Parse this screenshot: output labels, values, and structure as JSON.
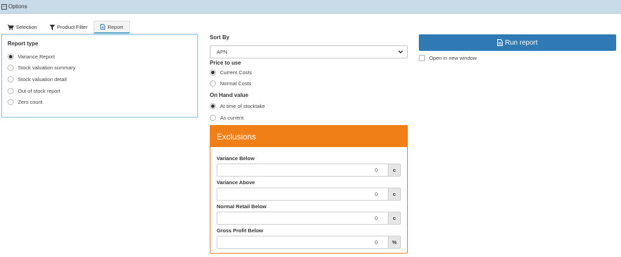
{
  "header": {
    "title": "Options",
    "collapse_icon": "minus-square-icon"
  },
  "tabs": [
    {
      "label": "Selection",
      "icon": "cart-icon",
      "active": false
    },
    {
      "label": "Product Filter",
      "icon": "filter-icon",
      "active": false
    },
    {
      "label": "Report",
      "icon": "document-icon",
      "active": true
    }
  ],
  "report_type": {
    "title": "Report type",
    "options": [
      {
        "label": "Variance Report",
        "checked": true
      },
      {
        "label": "Stock valuation summary",
        "checked": false
      },
      {
        "label": "Stock valuation detail",
        "checked": false
      },
      {
        "label": "Out of stock report",
        "checked": false
      },
      {
        "label": "Zero count",
        "checked": false
      }
    ]
  },
  "sort_by": {
    "label": "Sort By",
    "value": "APN"
  },
  "price_to_use": {
    "label": "Price to use",
    "options": [
      {
        "label": "Current Costs",
        "checked": true
      },
      {
        "label": "Normal Costs",
        "checked": false
      }
    ]
  },
  "on_hand": {
    "label": "On Hand value",
    "options": [
      {
        "label": "At time of stocktake",
        "checked": true
      },
      {
        "label": "As current",
        "checked": false
      }
    ]
  },
  "exclusions": {
    "title": "Exclusions",
    "accent": "#f07f17",
    "fields": [
      {
        "label": "Variance Below",
        "value": "0",
        "unit": "c"
      },
      {
        "label": "Variance Above",
        "value": "0",
        "unit": "c"
      },
      {
        "label": "Normal Retail Below",
        "value": "0",
        "unit": "c"
      },
      {
        "label": "Gross Profit Below",
        "value": "0",
        "unit": "%"
      }
    ]
  },
  "actions": {
    "run_label": "Run report",
    "run_color": "#2f79b5",
    "new_window_label": "Open in new window",
    "new_window_checked": false
  }
}
